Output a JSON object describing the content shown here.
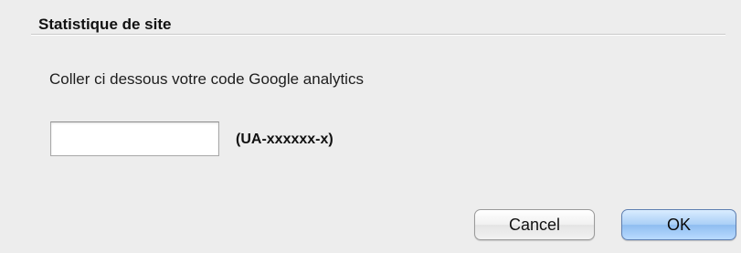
{
  "group": {
    "title": "Statistique de site"
  },
  "form": {
    "instruction": "Coller ci dessous votre code Google analytics",
    "code_value": "",
    "code_placeholder": "",
    "format_hint": "(UA-xxxxxx-x)"
  },
  "buttons": {
    "cancel_label": "Cancel",
    "ok_label": "OK"
  },
  "colors": {
    "dialog_background": "#ededed",
    "default_button_accent": "#a9cff6"
  }
}
